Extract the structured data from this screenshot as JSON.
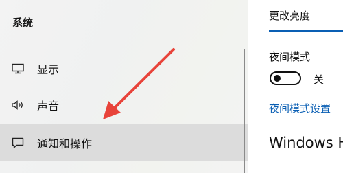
{
  "sidebar": {
    "title": "系统",
    "items": [
      {
        "label": "显示",
        "icon": "monitor-icon"
      },
      {
        "label": "声音",
        "icon": "speaker-icon"
      },
      {
        "label": "通知和操作",
        "icon": "notification-icon"
      }
    ],
    "selected_index": 2
  },
  "main": {
    "brightness_label": "更改亮度",
    "night_mode_label": "夜间模式",
    "night_mode_toggle": {
      "state_label": "关",
      "on": false
    },
    "night_mode_settings_link": "夜间模式设置",
    "windows_heading": "Windows H"
  },
  "annotation": {
    "type": "arrow",
    "color": "#e8433a"
  },
  "colors": {
    "accent": "#0a5fb4",
    "selected_bg": "#dcdcdc"
  }
}
